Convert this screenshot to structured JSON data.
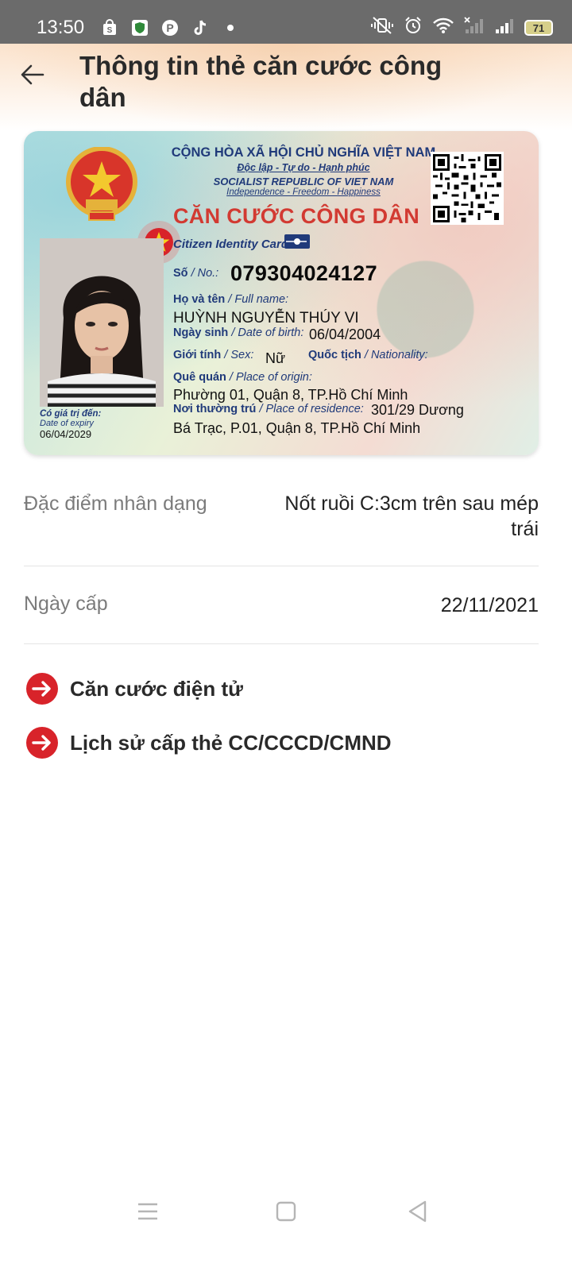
{
  "status_bar": {
    "time": "13:50",
    "battery": "71",
    "left_icons": [
      "shopping-bag-icon",
      "shield-app-icon",
      "pinterest-icon",
      "tiktok-icon",
      "dot-icon"
    ],
    "right_icons": [
      "vibrate-icon",
      "alarm-icon",
      "wifi-icon",
      "signal-off-icon",
      "signal-icon",
      "battery-icon"
    ]
  },
  "header": {
    "title": "Thông tin thẻ căn cước công dân"
  },
  "card": {
    "country_vn": "CỘNG HÒA XÃ HỘI CHỦ NGHĨA VIỆT NAM",
    "motto_vn": "Độc lập - Tự do - Hạnh phúc",
    "country_en": "SOCIALIST REPUBLIC OF VIET NAM",
    "motto_en": "Independence - Freedom - Happiness",
    "title": "CĂN CƯỚC CÔNG DÂN",
    "subtitle": "Citizen Identity Card",
    "number_label_vn": "Số",
    "number_label_en": "/ No.:",
    "number": "079304024127",
    "name_label_vn": "Họ và tên",
    "name_label_en": "/ Full name:",
    "name": "HUỲNH NGUYỄN THÚY VI",
    "dob_label_vn": "Ngày sinh",
    "dob_label_en": "/ Date of birth:",
    "dob": "06/04/2004",
    "sex_label_vn": "Giới tính",
    "sex_label_en": "/ Sex:",
    "sex": "Nữ",
    "nationality_label_vn": "Quốc tịch",
    "nationality_label_en": "/ Nationality:",
    "origin_label_vn": "Quê quán",
    "origin_label_en": "/ Place of origin:",
    "origin": "Phường 01, Quận 8, TP.Hồ Chí Minh",
    "residence_label_vn": "Nơi thường trú",
    "residence_label_en": "/ Place of residence:",
    "residence_line1": "301/29 Dương",
    "residence_line2": "Bá Trạc, P.01, Quận 8, TP.Hồ Chí Minh",
    "expiry_label_vn": "Có giá trị đến:",
    "expiry_label_en": "Date of expiry",
    "expiry": "06/04/2029"
  },
  "details": {
    "features_label": "Đặc điểm nhân dạng",
    "features_value": "Nốt ruồi C:3cm trên sau mép trái",
    "issue_date_label": "Ngày cấp",
    "issue_date_value": "22/11/2021"
  },
  "links": [
    {
      "label": "Căn cước điện tử"
    },
    {
      "label": "Lịch sử cấp thẻ CC/CCCD/CMND"
    }
  ],
  "colors": {
    "accent_red": "#d8232a",
    "card_blue": "#203a7a",
    "card_title_red": "#d23a32"
  }
}
